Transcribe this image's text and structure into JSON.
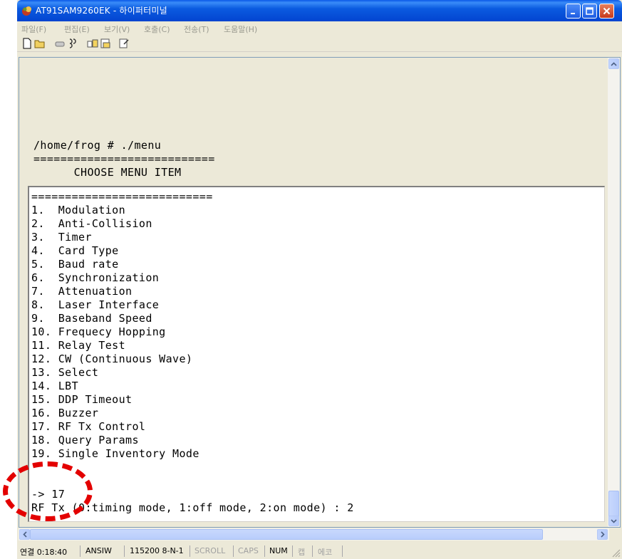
{
  "window": {
    "title": "AT91SAM9260EK - 하이퍼터미널"
  },
  "menu": [
    "파일(F)",
    "편집(E)",
    "보기(V)",
    "호출(C)",
    "전송(T)",
    "도움말(H)"
  ],
  "toolbar": [
    "new-icon",
    "open-icon",
    "disconnect-icon",
    "dial-icon",
    "send-icon",
    "receive-icon",
    "properties-icon"
  ],
  "terminal": {
    "upper_lines": [
      "/home/frog # ./menu",
      "===========================",
      "      CHOOSE MENU ITEM"
    ],
    "lines": [
      "===========================",
      "1.  Modulation",
      "2.  Anti-Collision",
      "3.  Timer",
      "4.  Card Type",
      "5.  Baud rate",
      "6.  Synchronization",
      "7.  Attenuation",
      "8.  Laser Interface",
      "9.  Baseband Speed",
      "10. Frequecy Hopping",
      "11. Relay Test",
      "12. CW (Continuous Wave)",
      "13. Select",
      "14. LBT",
      "15. DDP Timeout",
      "16. Buzzer",
      "17. RF Tx Control",
      "18. Query Params",
      "19. Single Inventory Mode",
      "",
      "",
      "-> 17",
      "RF Tx (0:timing mode, 1:off mode, 2:on mode) : 2"
    ]
  },
  "status": {
    "connected": "연결 0:18:40",
    "emulation": "ANSIW",
    "port": "115200 8-N-1",
    "scroll": "SCROLL",
    "caps": "CAPS",
    "num": "NUM",
    "kana": "캡",
    "echo": "에코"
  },
  "colors": {
    "title_blue": "#0344d0",
    "annotation_red": "#e30000"
  }
}
